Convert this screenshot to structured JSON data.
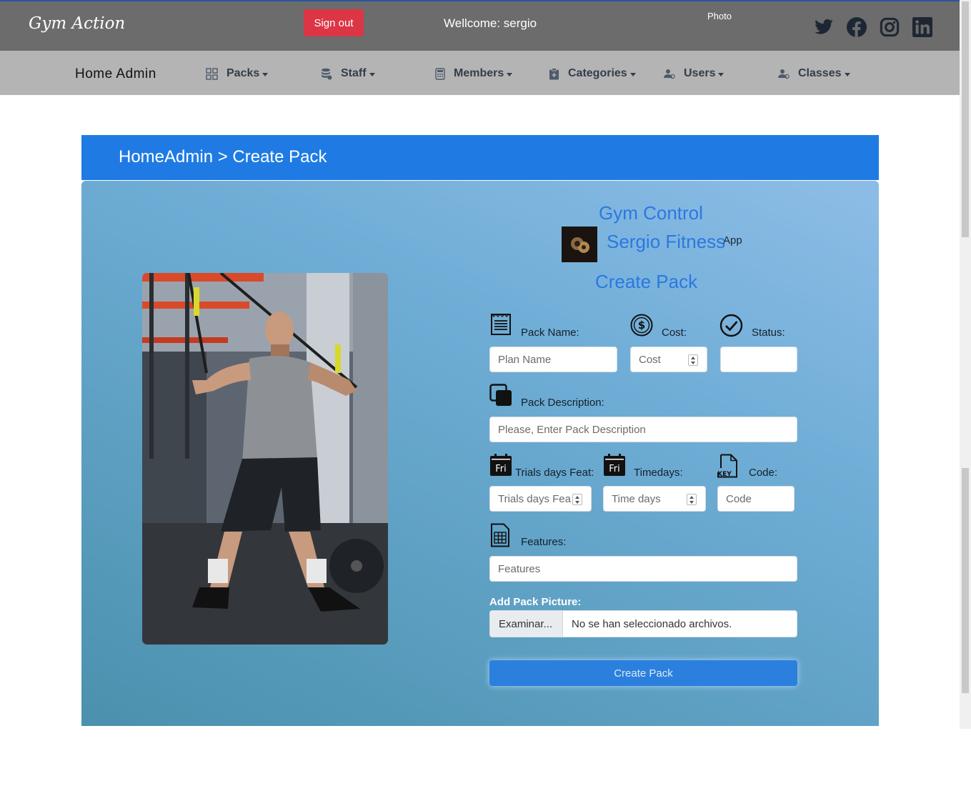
{
  "header": {
    "brand": "Gym Action",
    "signout_label": "Sign out",
    "welcome": "Wellcome: sergio",
    "photo_label": "Photo",
    "social": [
      "twitter-icon",
      "facebook-icon",
      "instagram-icon",
      "linkedin-icon"
    ]
  },
  "nav": {
    "home": "Home Admin",
    "items": [
      {
        "label": "Packs",
        "icon": "grid-icon"
      },
      {
        "label": "Staff",
        "icon": "coins-icon"
      },
      {
        "label": "Members",
        "icon": "calculator-icon"
      },
      {
        "label": "Categories",
        "icon": "clipboard-icon"
      },
      {
        "label": "Users",
        "icon": "users-icon"
      },
      {
        "label": "Classes",
        "icon": "users-icon"
      }
    ]
  },
  "breadcrumb": "HomeAdmin > Create Pack",
  "brand_block": {
    "title": "Gym Control",
    "app_name": "Sergio Fitness",
    "app_suffix": "App",
    "form_title": "Create Pack"
  },
  "form": {
    "pack_name_label": "Pack Name:",
    "pack_name_placeholder": "Plan Name",
    "cost_label": "Cost:",
    "cost_placeholder": "Cost",
    "status_label": "Status:",
    "status_value": "",
    "description_label": "Pack Description:",
    "description_placeholder": "Please, Enter Pack Description",
    "trials_label": "Trials days Feat:",
    "trials_placeholder": "Trials days Feat",
    "timedays_label": "Timedays:",
    "timedays_placeholder": "Time days",
    "code_label": "Code:",
    "code_placeholder": "Code",
    "features_label": "Features:",
    "features_placeholder": "Features",
    "picture_label": "Add Pack Picture:",
    "file_button": "Examinar...",
    "file_status": "No se han seleccionado archivos.",
    "submit_label": "Create Pack",
    "calendar_day": "Fri",
    "key_text": "KEY"
  },
  "colors": {
    "accent": "#1f7be3",
    "title_blue": "#2b78e0",
    "danger": "#dc3545",
    "topbar": "#6c6c6c",
    "navbar": "#b4b4b4"
  }
}
